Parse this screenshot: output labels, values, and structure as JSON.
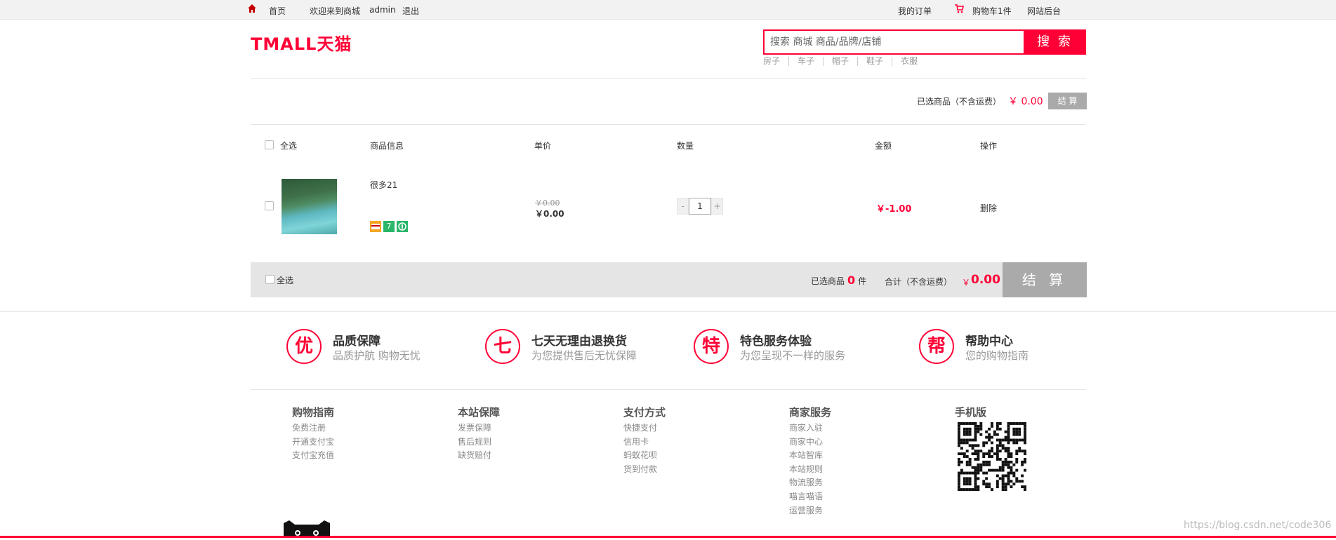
{
  "topbar": {
    "home_icon": "home-icon",
    "home": "首页",
    "welcome": "欢迎来到商城",
    "username": "admin",
    "logout": "退出",
    "my_orders": "我的订单",
    "cart_icon": "cart-icon",
    "cart": "购物车1件",
    "admin_site": "网站后台"
  },
  "header": {
    "logo": "TMALL天猫",
    "search_placeholder": "搜索 商城 商品/品牌/店铺",
    "search_button": "搜 索",
    "hot_words": [
      "房子",
      "车子",
      "帽子",
      "鞋子",
      "衣服"
    ]
  },
  "summary": {
    "label": "已选商品（不含运费）",
    "price": "￥  0.00",
    "checkout": "结 算"
  },
  "table_header": {
    "select_all": "全选",
    "info": "商品信息",
    "unit_price": "单价",
    "quantity": "数量",
    "amount": "金额",
    "operation": "操作"
  },
  "cart_items": [
    {
      "name": "很多21",
      "old_price": "￥0.00",
      "price": "￥0.00",
      "quantity": "1",
      "amount": "￥-1.00",
      "delete": "删除",
      "badges": [
        "credit-card-icon",
        "seven-day-icon",
        "gift-icon"
      ]
    }
  ],
  "bottom": {
    "select_all": "全选",
    "selected_prefix": "已选商品",
    "selected_count": "0",
    "selected_suffix": "件",
    "total_label": "合计（不含运费）",
    "yen": "￥",
    "total": "0.00",
    "checkout": "结 算"
  },
  "services": [
    {
      "glyph": "优",
      "title": "品质保障",
      "desc": "品质护航 购物无忧"
    },
    {
      "glyph": "七",
      "title": "七天无理由退换货",
      "desc": "为您提供售后无忧保障"
    },
    {
      "glyph": "特",
      "title": "特色服务体验",
      "desc": "为您呈现不一样的服务"
    },
    {
      "glyph": "帮",
      "title": "帮助中心",
      "desc": "您的购物指南"
    }
  ],
  "footer": [
    {
      "title": "购物指南",
      "links": [
        "免费注册",
        "开通支付宝",
        "支付宝充值"
      ]
    },
    {
      "title": "本站保障",
      "links": [
        "发票保障",
        "售后规则",
        "缺货赔付"
      ]
    },
    {
      "title": "支付方式",
      "links": [
        "快捷支付",
        "信用卡",
        "蚂蚁花呗",
        "货到付款"
      ]
    },
    {
      "title": "商家服务",
      "links": [
        "商家入驻",
        "商家中心",
        "本站智库",
        "本站规则",
        "物流服务",
        "喵言喵语",
        "运营服务"
      ]
    },
    {
      "title": "手机版",
      "links": []
    }
  ],
  "watermark": "https://blog.csdn.net/code306",
  "colors": {
    "brand": "#ff0036",
    "disabled_button": "#aaaaaa",
    "bar_bg": "#e5e5e5"
  }
}
